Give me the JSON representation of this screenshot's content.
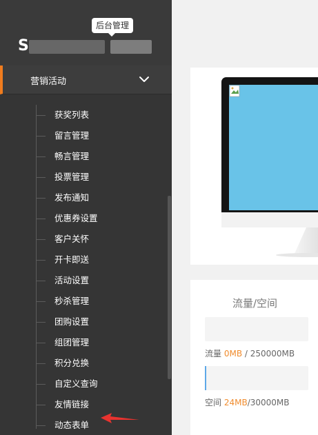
{
  "sidebar": {
    "tooltip": "后台管理",
    "logo": "S",
    "menu_header": {
      "label": "营销活动",
      "expanded": true
    },
    "submenu": [
      {
        "label": "获奖列表"
      },
      {
        "label": "留言管理"
      },
      {
        "label": "畅言管理"
      },
      {
        "label": "投票管理"
      },
      {
        "label": "发布通知"
      },
      {
        "label": "优惠券设置"
      },
      {
        "label": "客户关怀"
      },
      {
        "label": "开卡即送"
      },
      {
        "label": "活动设置"
      },
      {
        "label": "秒杀管理"
      },
      {
        "label": "团购设置"
      },
      {
        "label": "组团管理"
      },
      {
        "label": "积分兑换"
      },
      {
        "label": "自定义查询"
      },
      {
        "label": "友情链接"
      },
      {
        "label": "动态表单"
      }
    ]
  },
  "stats": {
    "title": "流量/空间",
    "flow": {
      "label": "流量",
      "used": "0MB",
      "total": " / 250000MB",
      "fraction": 0
    },
    "space": {
      "label": "空间",
      "used": "24MB",
      "total": "/30000MB",
      "fraction": 0.0008
    }
  },
  "colors": {
    "accent": "#f07c1e",
    "sidebar_bg": "#353535",
    "screen_blue": "#69c3e8",
    "arrow_red": "#e8332f",
    "highlight": "#f08c2e"
  }
}
